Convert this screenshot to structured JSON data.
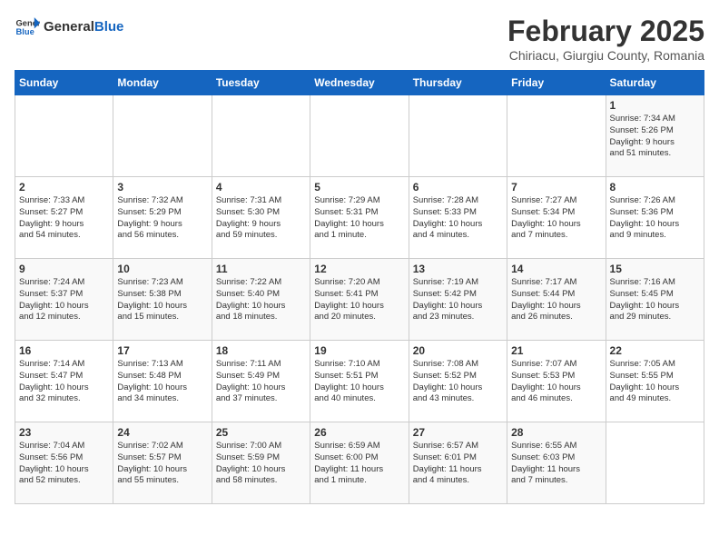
{
  "header": {
    "logo_general": "General",
    "logo_blue": "Blue",
    "title": "February 2025",
    "subtitle": "Chiriacu, Giurgiu County, Romania"
  },
  "weekdays": [
    "Sunday",
    "Monday",
    "Tuesday",
    "Wednesday",
    "Thursday",
    "Friday",
    "Saturday"
  ],
  "weeks": [
    [
      {
        "day": "",
        "info": ""
      },
      {
        "day": "",
        "info": ""
      },
      {
        "day": "",
        "info": ""
      },
      {
        "day": "",
        "info": ""
      },
      {
        "day": "",
        "info": ""
      },
      {
        "day": "",
        "info": ""
      },
      {
        "day": "1",
        "info": "Sunrise: 7:34 AM\nSunset: 5:26 PM\nDaylight: 9 hours\nand 51 minutes."
      }
    ],
    [
      {
        "day": "2",
        "info": "Sunrise: 7:33 AM\nSunset: 5:27 PM\nDaylight: 9 hours\nand 54 minutes."
      },
      {
        "day": "3",
        "info": "Sunrise: 7:32 AM\nSunset: 5:29 PM\nDaylight: 9 hours\nand 56 minutes."
      },
      {
        "day": "4",
        "info": "Sunrise: 7:31 AM\nSunset: 5:30 PM\nDaylight: 9 hours\nand 59 minutes."
      },
      {
        "day": "5",
        "info": "Sunrise: 7:29 AM\nSunset: 5:31 PM\nDaylight: 10 hours\nand 1 minute."
      },
      {
        "day": "6",
        "info": "Sunrise: 7:28 AM\nSunset: 5:33 PM\nDaylight: 10 hours\nand 4 minutes."
      },
      {
        "day": "7",
        "info": "Sunrise: 7:27 AM\nSunset: 5:34 PM\nDaylight: 10 hours\nand 7 minutes."
      },
      {
        "day": "8",
        "info": "Sunrise: 7:26 AM\nSunset: 5:36 PM\nDaylight: 10 hours\nand 9 minutes."
      }
    ],
    [
      {
        "day": "9",
        "info": "Sunrise: 7:24 AM\nSunset: 5:37 PM\nDaylight: 10 hours\nand 12 minutes."
      },
      {
        "day": "10",
        "info": "Sunrise: 7:23 AM\nSunset: 5:38 PM\nDaylight: 10 hours\nand 15 minutes."
      },
      {
        "day": "11",
        "info": "Sunrise: 7:22 AM\nSunset: 5:40 PM\nDaylight: 10 hours\nand 18 minutes."
      },
      {
        "day": "12",
        "info": "Sunrise: 7:20 AM\nSunset: 5:41 PM\nDaylight: 10 hours\nand 20 minutes."
      },
      {
        "day": "13",
        "info": "Sunrise: 7:19 AM\nSunset: 5:42 PM\nDaylight: 10 hours\nand 23 minutes."
      },
      {
        "day": "14",
        "info": "Sunrise: 7:17 AM\nSunset: 5:44 PM\nDaylight: 10 hours\nand 26 minutes."
      },
      {
        "day": "15",
        "info": "Sunrise: 7:16 AM\nSunset: 5:45 PM\nDaylight: 10 hours\nand 29 minutes."
      }
    ],
    [
      {
        "day": "16",
        "info": "Sunrise: 7:14 AM\nSunset: 5:47 PM\nDaylight: 10 hours\nand 32 minutes."
      },
      {
        "day": "17",
        "info": "Sunrise: 7:13 AM\nSunset: 5:48 PM\nDaylight: 10 hours\nand 34 minutes."
      },
      {
        "day": "18",
        "info": "Sunrise: 7:11 AM\nSunset: 5:49 PM\nDaylight: 10 hours\nand 37 minutes."
      },
      {
        "day": "19",
        "info": "Sunrise: 7:10 AM\nSunset: 5:51 PM\nDaylight: 10 hours\nand 40 minutes."
      },
      {
        "day": "20",
        "info": "Sunrise: 7:08 AM\nSunset: 5:52 PM\nDaylight: 10 hours\nand 43 minutes."
      },
      {
        "day": "21",
        "info": "Sunrise: 7:07 AM\nSunset: 5:53 PM\nDaylight: 10 hours\nand 46 minutes."
      },
      {
        "day": "22",
        "info": "Sunrise: 7:05 AM\nSunset: 5:55 PM\nDaylight: 10 hours\nand 49 minutes."
      }
    ],
    [
      {
        "day": "23",
        "info": "Sunrise: 7:04 AM\nSunset: 5:56 PM\nDaylight: 10 hours\nand 52 minutes."
      },
      {
        "day": "24",
        "info": "Sunrise: 7:02 AM\nSunset: 5:57 PM\nDaylight: 10 hours\nand 55 minutes."
      },
      {
        "day": "25",
        "info": "Sunrise: 7:00 AM\nSunset: 5:59 PM\nDaylight: 10 hours\nand 58 minutes."
      },
      {
        "day": "26",
        "info": "Sunrise: 6:59 AM\nSunset: 6:00 PM\nDaylight: 11 hours\nand 1 minute."
      },
      {
        "day": "27",
        "info": "Sunrise: 6:57 AM\nSunset: 6:01 PM\nDaylight: 11 hours\nand 4 minutes."
      },
      {
        "day": "28",
        "info": "Sunrise: 6:55 AM\nSunset: 6:03 PM\nDaylight: 11 hours\nand 7 minutes."
      },
      {
        "day": "",
        "info": ""
      }
    ]
  ]
}
